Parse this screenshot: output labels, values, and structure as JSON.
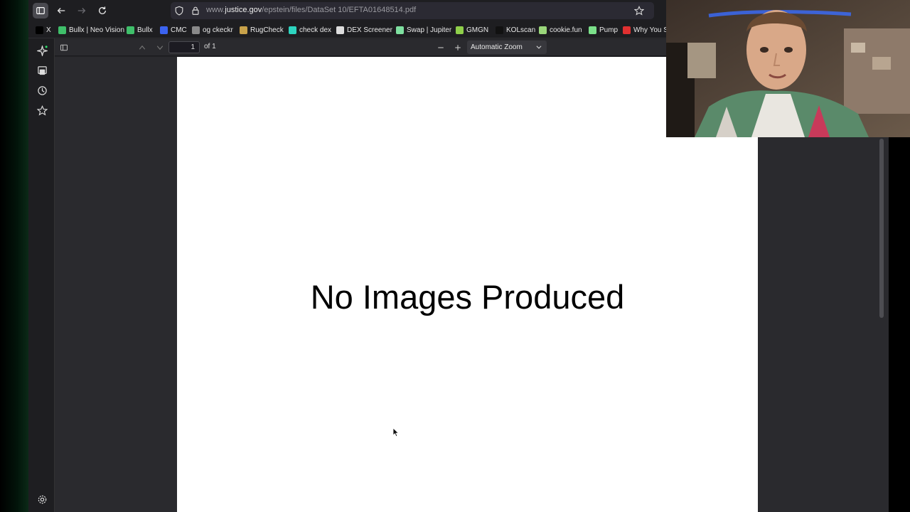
{
  "browser": {
    "url_prefix": "www.",
    "url_host": "justice.gov",
    "url_path": "/epstein/files/DataSet 10/EFTA01648514.pdf"
  },
  "bookmarks": [
    {
      "label": "X",
      "icon": "x-logo-icon",
      "color": "#000000"
    },
    {
      "label": "Bullx | Neo Vision",
      "icon": "bullx-icon",
      "color": "#3fbf6a"
    },
    {
      "label": "Bullx",
      "icon": "bullx-icon",
      "color": "#3fbf6a"
    },
    {
      "label": "CMC",
      "icon": "cmc-icon",
      "color": "#3b63f0"
    },
    {
      "label": "og ckeckr",
      "icon": "globe-icon",
      "color": "#8a8a8a"
    },
    {
      "label": "RugCheck",
      "icon": "rugcheck-icon",
      "color": "#c8a24a"
    },
    {
      "label": "check dex",
      "icon": "dex-icon",
      "color": "#2dd4bf"
    },
    {
      "label": "DEX Screener",
      "icon": "dexscreener-icon",
      "color": "#dddddd"
    },
    {
      "label": "Swap | Jupiter",
      "icon": "jupiter-icon",
      "color": "#7ee0a0"
    },
    {
      "label": "GMGN",
      "icon": "gmgn-icon",
      "color": "#8fcf4a"
    },
    {
      "label": "KOLscan",
      "icon": "kolscan-icon",
      "color": "#111111"
    },
    {
      "label": "cookie.fun",
      "icon": "cookie-icon",
      "color": "#9ad67a"
    },
    {
      "label": "Pump",
      "icon": "pump-pill-icon",
      "color": "#7be08a"
    },
    {
      "label": "Why You S",
      "icon": "youtube-icon",
      "color": "#e03030"
    }
  ],
  "pdf_toolbar": {
    "page_value": "1",
    "page_count": "of 1",
    "zoom": "Automatic Zoom"
  },
  "document": {
    "text": "No Images Produced"
  },
  "colors": {
    "accent": "#2ee66f",
    "page": "#ffffff",
    "chrome": "#1e1e21"
  }
}
